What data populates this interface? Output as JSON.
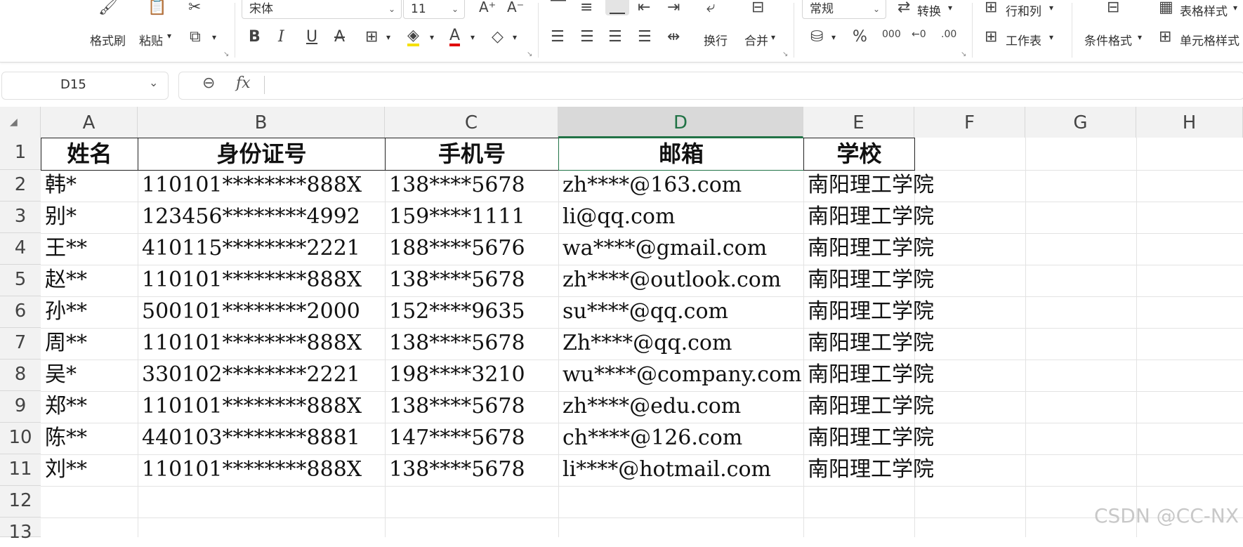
{
  "ribbon": {
    "clipboard": {
      "format_painter": "格式刷",
      "paste": "粘贴"
    },
    "font": {
      "name": "宋体",
      "size": "11"
    },
    "alignment": {
      "wrap": "换行",
      "merge": "合并"
    },
    "number": {
      "format": "常规",
      "convert": "转换"
    },
    "cells": {
      "rows_cols": "行和列",
      "worksheet": "工作表"
    },
    "styles": {
      "conditional": "条件格式",
      "table_style": "表格样式",
      "cell_style": "单元格样式"
    }
  },
  "formula_bar": {
    "name_box": "D15",
    "fx": "fx"
  },
  "columns": [
    "A",
    "B",
    "C",
    "D",
    "E",
    "F",
    "G",
    "H"
  ],
  "rows": [
    "1",
    "2",
    "3",
    "4",
    "5",
    "6",
    "7",
    "8",
    "9",
    "10",
    "11",
    "12",
    "13"
  ],
  "headers": [
    "姓名",
    "身份证号",
    "手机号",
    "邮箱",
    "学校"
  ],
  "data": [
    [
      "韩*",
      "110101********888X",
      "138****5678",
      "zh****@163.com",
      "南阳理工学院"
    ],
    [
      "别*",
      "123456********4992",
      "159****1111",
      "li@qq.com",
      "南阳理工学院"
    ],
    [
      "王**",
      "410115********2221",
      "188****5676",
      "wa****@gmail.com",
      "南阳理工学院"
    ],
    [
      "赵**",
      "110101********888X",
      "138****5678",
      "zh****@outlook.com",
      "南阳理工学院"
    ],
    [
      "孙**",
      "500101********2000",
      "152****9635",
      "su****@qq.com",
      "南阳理工学院"
    ],
    [
      "周**",
      "110101********888X",
      "138****5678",
      "Zh****@qq.com",
      "南阳理工学院"
    ],
    [
      "吴*",
      "330102********2221",
      "198****3210",
      "wu****@company.com",
      "南阳理工学院"
    ],
    [
      "郑**",
      "110101********888X",
      "138****5678",
      "zh****@edu.com",
      "南阳理工学院"
    ],
    [
      "陈**",
      "440103********8881",
      "147****5678",
      "ch****@126.com",
      "南阳理工学院"
    ],
    [
      "刘**",
      "110101********888X",
      "138****5678",
      "li****@hotmail.com",
      "南阳理工学院"
    ]
  ],
  "watermark": "CSDN @CC-NX",
  "colors": {
    "accent": "#217346"
  }
}
